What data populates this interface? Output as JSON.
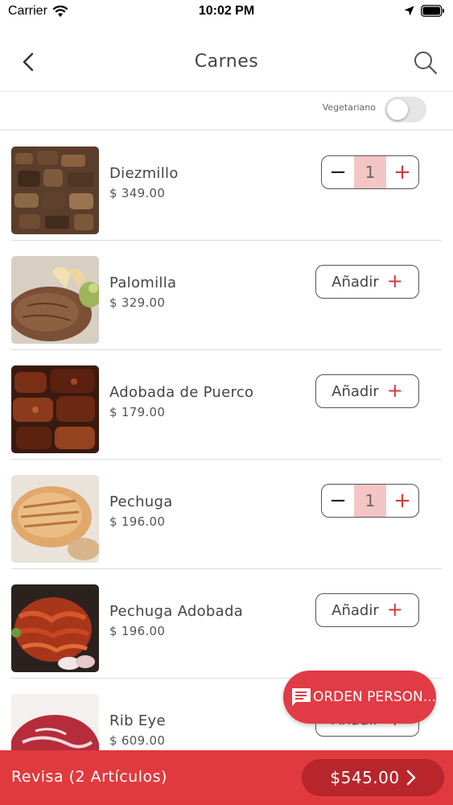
{
  "status_bar": {
    "carrier": "Carrier",
    "time": "10:02 PM"
  },
  "header": {
    "title": "Carnes",
    "back_icon": "chevron-left-icon",
    "search_icon": "search-icon"
  },
  "filter": {
    "vegetarian_label": "Vegetariano",
    "vegetarian_on": false
  },
  "products": [
    {
      "name": "Diezmillo",
      "price": "$ 349.00",
      "state": "stepper",
      "quantity": "1"
    },
    {
      "name": "Palomilla",
      "price": "$ 329.00",
      "state": "add",
      "add_label": "Añadir"
    },
    {
      "name": "Adobada de Puerco",
      "price": "$ 179.00",
      "state": "add",
      "add_label": "Añadir"
    },
    {
      "name": "Pechuga",
      "price": "$ 196.00",
      "state": "stepper",
      "quantity": "1"
    },
    {
      "name": "Pechuga Adobada",
      "price": "$ 196.00",
      "state": "add",
      "add_label": "Añadir"
    },
    {
      "name": "Rib Eye",
      "price": "$ 609.00",
      "state": "add",
      "add_label": "Añadir"
    }
  ],
  "fab": {
    "label": "ORDEN PERSON...",
    "icon": "message-icon"
  },
  "bottom_bar": {
    "label": "Revisa (2 Artículos)",
    "total": "$545.00"
  },
  "colors": {
    "accent": "#e03a3e",
    "accent_dark": "#b8262c",
    "stepper_highlight": "#f4c5c5"
  }
}
